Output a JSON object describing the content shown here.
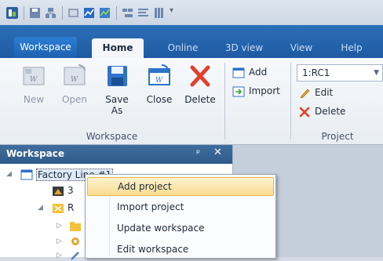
{
  "ribbon_tabs": {
    "file": "Workspace",
    "home": "Home",
    "online": "Online",
    "view3d": "3D view",
    "view": "View",
    "help": "Help"
  },
  "workspace_group": {
    "new": "New",
    "open": "Open",
    "save_as_line1": "Save",
    "save_as_line2": "As",
    "close": "Close",
    "delete": "Delete",
    "label": "Workspace"
  },
  "add_import": {
    "add": "Add",
    "import": "Import"
  },
  "project_group": {
    "selected_project": "1:RC1",
    "edit": "Edit",
    "delete": "Delete",
    "label": "Project"
  },
  "panel": {
    "title": "Workspace",
    "pin": "ᵖ",
    "close": "✕"
  },
  "tree": {
    "root": "Factory Line #1",
    "child1_prefix": "3",
    "child2_prefix": "R"
  },
  "context_menu": {
    "items": [
      "Add project",
      "Import project",
      "Update workspace",
      "Edit workspace"
    ]
  },
  "colors": {
    "tab_bar": "#1f5aa2",
    "highlight": "#f9dc8f",
    "delete_red": "#e0402a"
  }
}
